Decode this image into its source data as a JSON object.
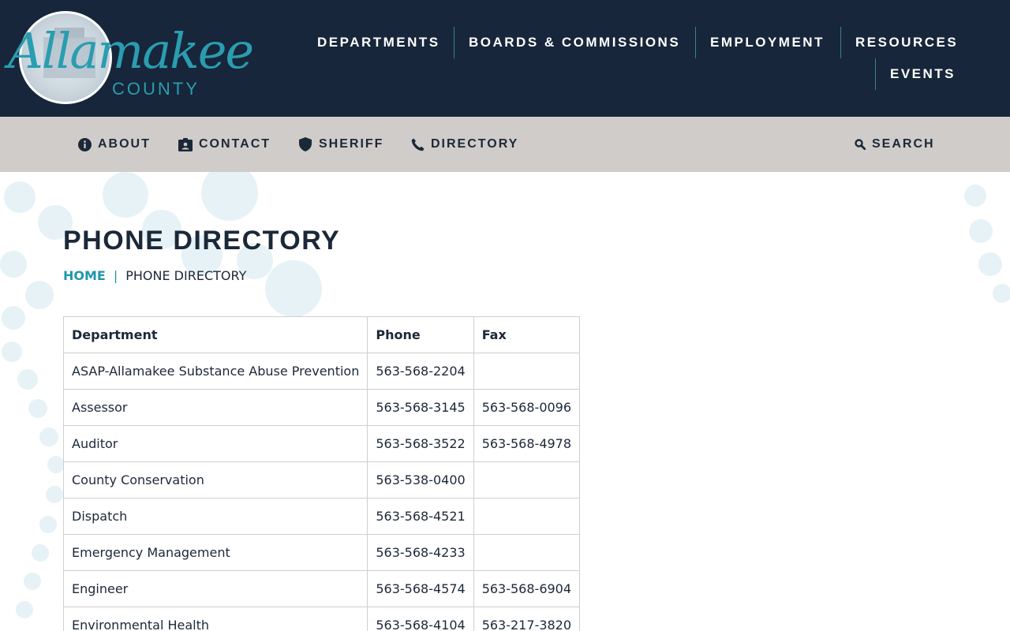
{
  "logo": {
    "script_text": "Allamakee",
    "sub_text": "COUNTY"
  },
  "main_nav": [
    {
      "label": "DEPARTMENTS"
    },
    {
      "label": "BOARDS & COMMISSIONS"
    },
    {
      "label": "EMPLOYMENT"
    },
    {
      "label": "RESOURCES"
    },
    {
      "label": "EVENTS"
    }
  ],
  "sub_nav": {
    "items": [
      {
        "label": "ABOUT",
        "icon": "info-icon"
      },
      {
        "label": "CONTACT",
        "icon": "contact-card-icon"
      },
      {
        "label": "SHERIFF",
        "icon": "shield-icon"
      },
      {
        "label": "DIRECTORY",
        "icon": "phone-icon"
      }
    ],
    "search": {
      "label": "SEARCH",
      "icon": "search-icon"
    }
  },
  "page": {
    "title": "PHONE DIRECTORY",
    "breadcrumb": {
      "home": "HOME",
      "separator": "|",
      "current": "PHONE DIRECTORY"
    }
  },
  "table": {
    "headers": [
      "Department",
      "Phone",
      "Fax"
    ],
    "rows": [
      [
        "ASAP-Allamakee Substance Abuse Prevention",
        "563-568-2204",
        ""
      ],
      [
        "Assessor",
        "563-568-3145",
        "563-568-0096"
      ],
      [
        "Auditor",
        "563-568-3522",
        "563-568-4978"
      ],
      [
        "County Conservation",
        "563-538-0400",
        ""
      ],
      [
        "Dispatch",
        "563-568-4521",
        ""
      ],
      [
        "Emergency Management",
        "563-568-4233",
        ""
      ],
      [
        "Engineer",
        "563-568-4574",
        "563-568-6904"
      ],
      [
        "Environmental Health",
        "563-568-4104",
        "563-217-3820"
      ]
    ]
  },
  "colors": {
    "header_bg": "#17263a",
    "subnav_bg": "#d0ccc9",
    "accent": "#1f97ad",
    "text": "#1b2838"
  }
}
